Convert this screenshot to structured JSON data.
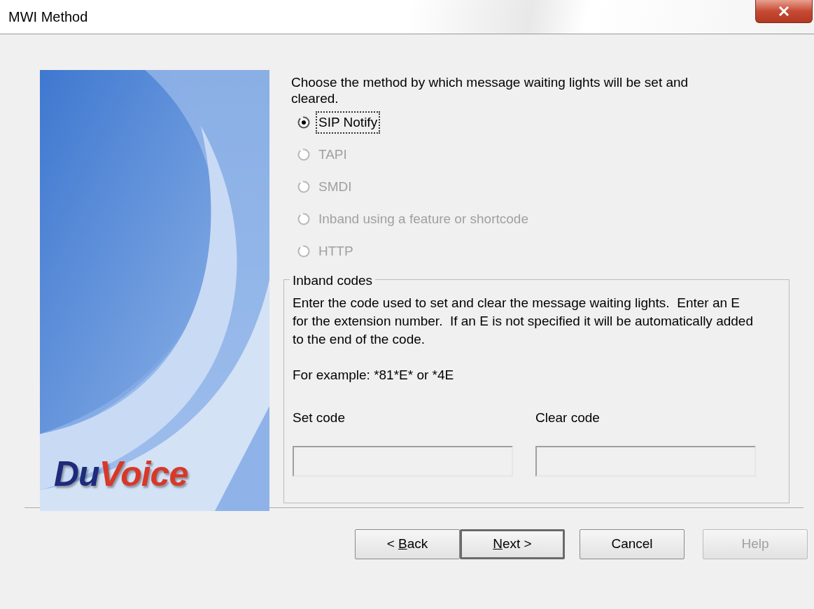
{
  "window": {
    "title": "MWI Method"
  },
  "banner": {
    "kind": "picture",
    "logo": [
      {
        "text": "Du",
        "color": "#1e2a7a"
      },
      {
        "text": "Voice",
        "color": "#d8382a"
      }
    ]
  },
  "instruction": "Choose the method by which message waiting lights will be set and cleared.",
  "methods": [
    {
      "label": "SIP Notify",
      "selected": true,
      "disabled": false,
      "focused": true
    },
    {
      "label": "TAPI",
      "selected": false,
      "disabled": true,
      "focused": false
    },
    {
      "label": "SMDI",
      "selected": false,
      "disabled": true,
      "focused": false
    },
    {
      "label": "Inband using a feature or shortcode",
      "selected": false,
      "disabled": true,
      "focused": false
    },
    {
      "label": "HTTP",
      "selected": false,
      "disabled": true,
      "focused": false
    }
  ],
  "inband": {
    "title": "Inband codes",
    "description": "Enter the code used to set and clear the message waiting lights.  Enter an E for the extension number.  If an E is not specified it will be automatically added to the end of the code.",
    "example": "For example: *81*E* or *4E",
    "fields": [
      {
        "label": "Set code",
        "disabled": true
      },
      {
        "label": "Clear code",
        "disabled": true
      }
    ]
  },
  "buttons": [
    {
      "before": "< ",
      "key": "B",
      "after": "ack",
      "default": false,
      "disabled": false
    },
    {
      "key": "N",
      "after": "ext >",
      "default": true,
      "disabled": false
    },
    {
      "before": "Cancel",
      "default": false,
      "disabled": false
    },
    {
      "before": "Help",
      "default": false,
      "disabled": true
    }
  ]
}
